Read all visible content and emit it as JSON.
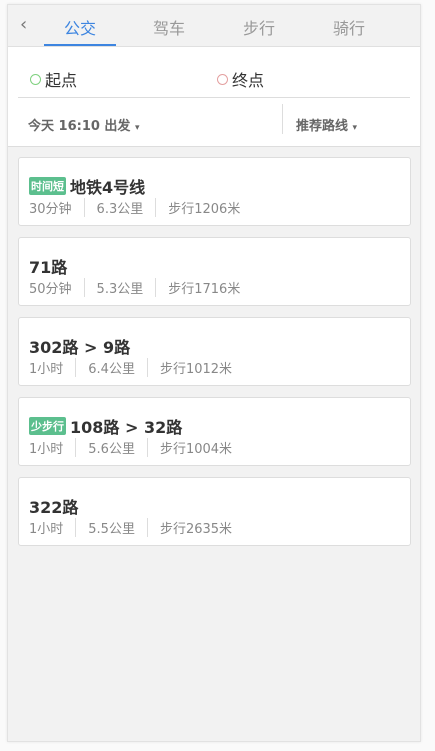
{
  "tabs": [
    {
      "label": "公交",
      "active": true
    },
    {
      "label": "驾车"
    },
    {
      "label": "步行"
    },
    {
      "label": "骑行"
    }
  ],
  "colors": {
    "accent": "#3d85e0",
    "start": "#7fd17f",
    "end": "#e4a0a0",
    "badge": "#5cbf8e"
  },
  "form": {
    "start": "起点",
    "end": "终点",
    "depart": "今天 16:10 出发",
    "sort": "推荐路线"
  },
  "routes": [
    {
      "badge": "时间短",
      "name": "地铁4号线",
      "time": "30分钟",
      "distance": "6.3公里",
      "walk": "步行1206米"
    },
    {
      "badge": "",
      "name": "71路",
      "time": "50分钟",
      "distance": "5.3公里",
      "walk": "步行1716米"
    },
    {
      "badge": "",
      "name": "302路 > 9路",
      "time": "1小时",
      "distance": "6.4公里",
      "walk": "步行1012米"
    },
    {
      "badge": "少步行",
      "name": "108路 > 32路",
      "time": "1小时",
      "distance": "5.6公里",
      "walk": "步行1004米"
    },
    {
      "badge": "",
      "name": "322路",
      "time": "1小时",
      "distance": "5.5公里",
      "walk": "步行2635米"
    }
  ]
}
